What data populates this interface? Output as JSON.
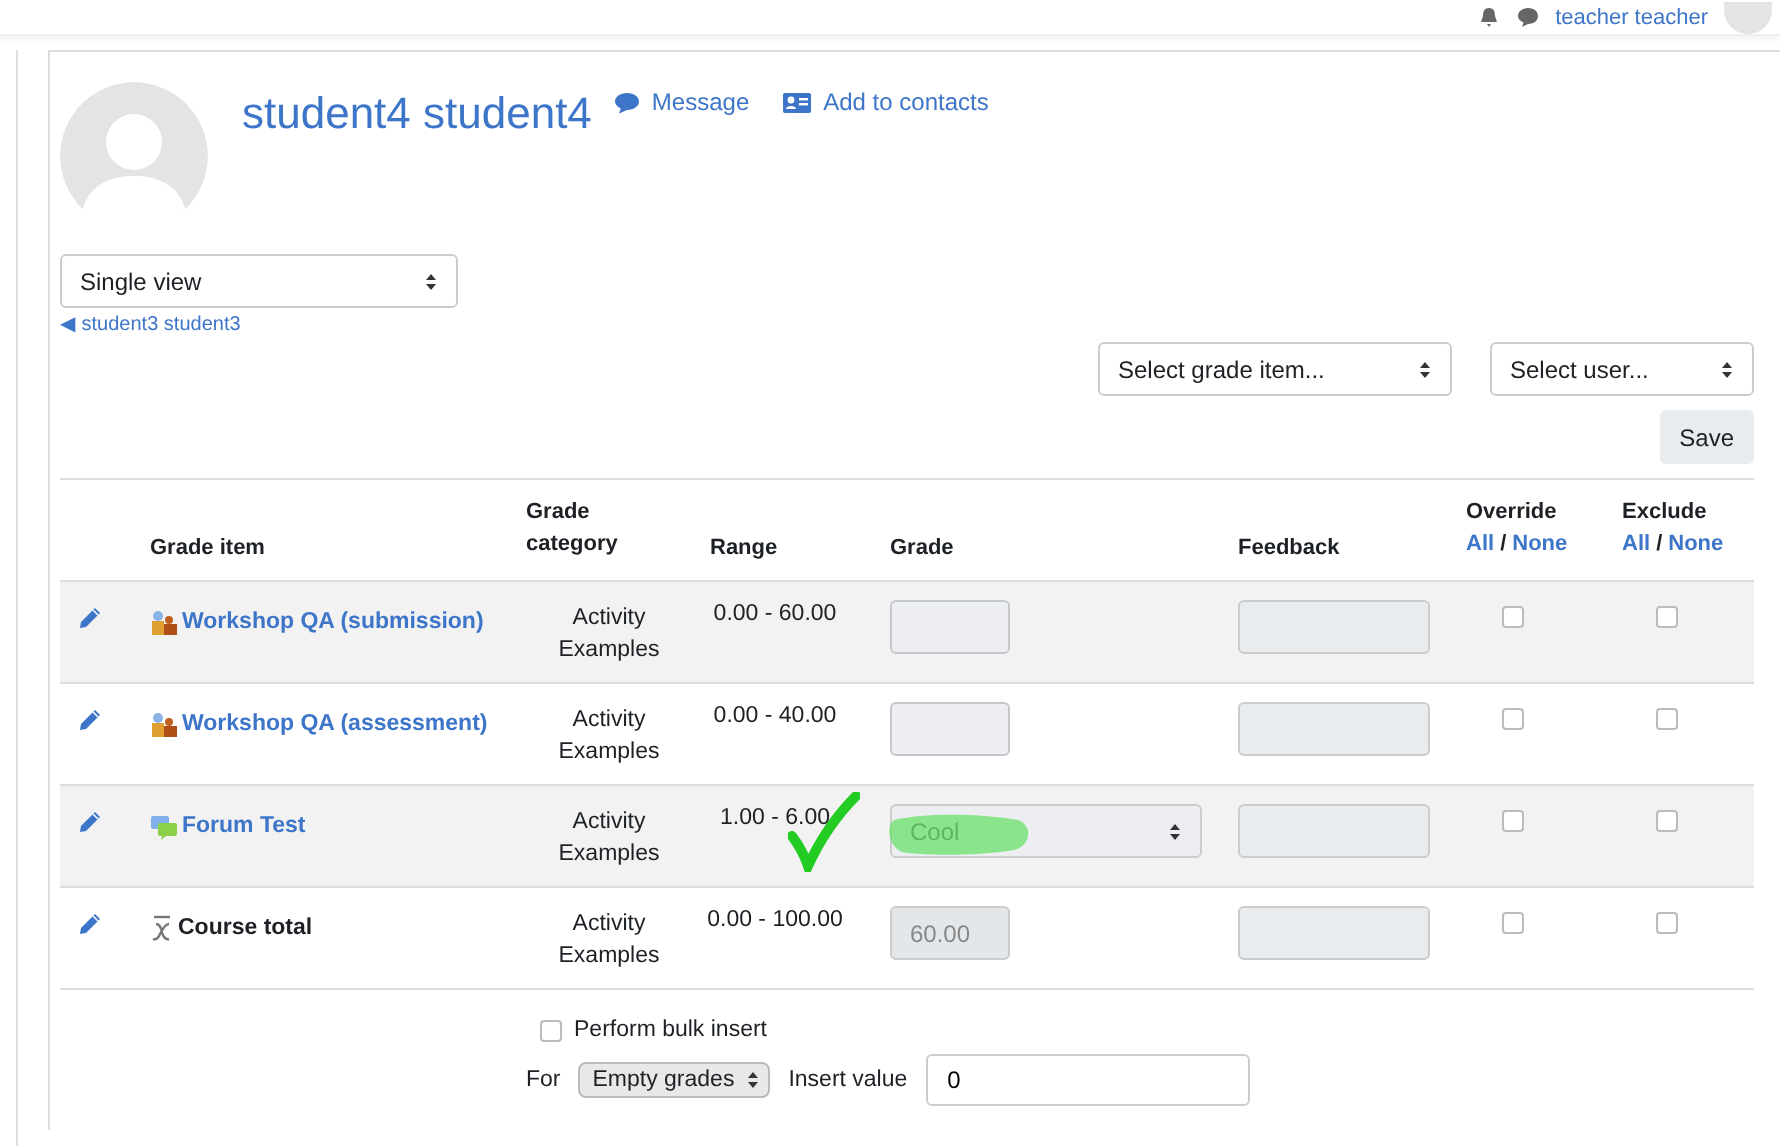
{
  "top_bar": {
    "user": "teacher teacher"
  },
  "profile": {
    "name": "student4 student4",
    "actions": [
      {
        "kind": "message",
        "label": "Message"
      },
      {
        "kind": "contact",
        "label": "Add to contacts"
      }
    ]
  },
  "view_select": {
    "value": "Single view"
  },
  "previous_link": "◀ student3 student3",
  "selectors": [
    {
      "value": "Select grade item..."
    },
    {
      "value": "Select user..."
    }
  ],
  "save_button": "Save",
  "table": {
    "columns": [
      "Grade item",
      "Grade category",
      "Range",
      "Grade",
      "Feedback"
    ],
    "toggle_columns": [
      {
        "title": "Override",
        "all": "All",
        "sep": "/",
        "none": "None"
      },
      {
        "title": "Exclude",
        "all": "All",
        "sep": "/",
        "none": "None"
      }
    ],
    "rows": [
      {
        "kind": "workshop",
        "item": "Workshop QA (submission)",
        "category": "Activity Examples",
        "range": "0.00 - 60.00",
        "grade": {
          "kind": "text"
        },
        "override": false,
        "exclude": false
      },
      {
        "kind": "workshop",
        "item": "Workshop QA (assessment)",
        "category": "Activity Examples",
        "range": "0.00 - 40.00",
        "grade": {
          "kind": "text"
        },
        "override": false,
        "exclude": false
      },
      {
        "kind": "forum",
        "item": "Forum Test",
        "category": "Activity Examples",
        "range": "1.00 - 6.00",
        "grade": {
          "kind": "select",
          "value": "Cool",
          "disabled": false
        },
        "override": false,
        "exclude": false
      },
      {
        "kind": "total",
        "item": "Course total",
        "category": "Activity Examples",
        "range": "0.00 - 100.00",
        "grade": {
          "kind": "text",
          "value": "60.00",
          "disabled": true
        },
        "override": false,
        "exclude": false
      }
    ]
  },
  "bulk": {
    "checked": false,
    "label": "Perform bulk insert",
    "for_label": "For",
    "for_value": "Empty grades",
    "value_label": "Insert value",
    "value": "0"
  }
}
